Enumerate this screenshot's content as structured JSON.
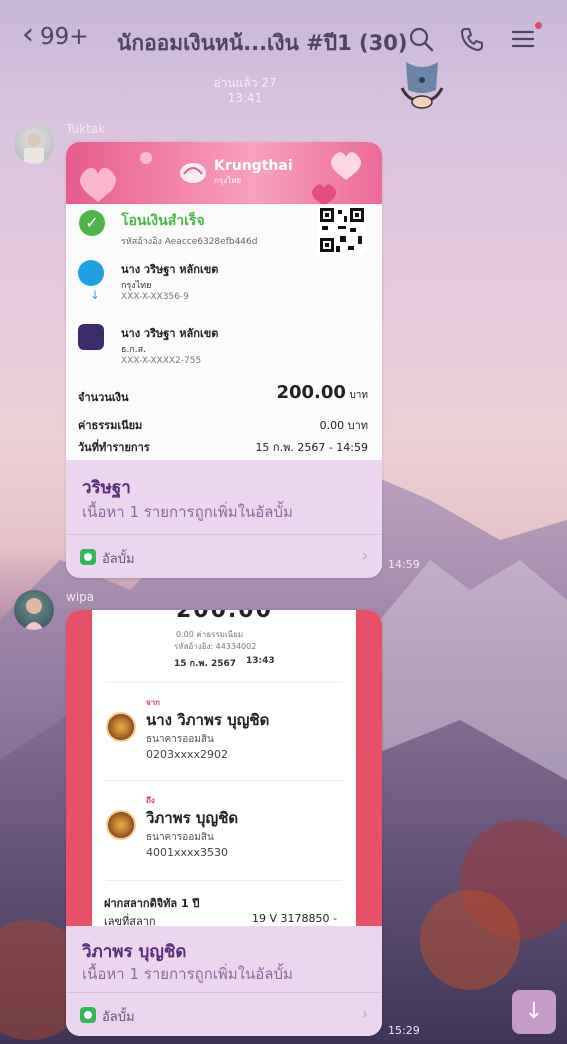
{
  "header": {
    "back_label": "99+",
    "title": "นักออมเงินหน้...เงิน #ปี1 (30)"
  },
  "read_status": {
    "label": "อ่านแล้ว 27",
    "time": "13:41"
  },
  "messages": [
    {
      "sender": "Tuktak",
      "time": "14:59",
      "slip": {
        "brand_name": "Krungthai",
        "brand_sub": "กรุงไทย",
        "status": "โอนเงินสำเร็จ",
        "ref": "รหัสอ้างอิง Aeacce6328efb446d",
        "from_name": "นาง วริษฐา หลักเขต",
        "from_bank": "กรุงไทย",
        "from_acct": "XXX-X-XX356-9",
        "to_name": "นาง วริษฐา หลักเขต",
        "to_bank": "ธ.ก.ส.",
        "to_acct": "XXX-X-XXXX2-755",
        "amount_label": "จำนวนเงิน",
        "amount": "200.00",
        "amount_unit": "บาท",
        "fee_label": "ค่าธรรมเนียม",
        "fee": "0.00 บาท",
        "date_label": "วันที่ทำรายการ",
        "date": "15 ก.พ. 2567 - 14:59"
      },
      "album_title": "วริษฐา",
      "album_desc": "เนื้อหา 1 รายการถูกเพิ่มในอัลบั้ม",
      "album_label": "อัลบั้ม"
    },
    {
      "sender": "wipa",
      "time": "15:29",
      "slip": {
        "amount_cut": "200.00",
        "fee_line": "0.00 ค่าธรรมเนียม",
        "ref_line": "รหัสอ้างอิง: 44334002",
        "date": "15 ก.พ. 2567",
        "time": "13:43",
        "from_tag": "จาก",
        "from_name": "นาง วิภาพร บุญชิด",
        "from_bank": "ธนาคารออมสิน",
        "from_acct": "0203xxxx2902",
        "to_tag": "ถึง",
        "to_name": "วิภาพร บุญชิด",
        "to_bank": "ธนาคารออมสิน",
        "to_acct": "4001xxxx3530",
        "product": "ฝากสลากดิจิทัล 1 ปี",
        "lot_label": "เลขที่สลาก",
        "lot_value": "19 V 3178850 -"
      },
      "album_title": "วิภาพร บุญชิด",
      "album_desc": "เนื้อหา 1 รายการถูกเพิ่มในอัลบั้ม",
      "album_label": "อัลบั้ม"
    }
  ],
  "icons": {
    "search": "search-icon",
    "call": "phone-icon",
    "menu": "menu-icon",
    "scroll": "arrow-down-icon"
  },
  "colors": {
    "success_green": "#4cb748",
    "album_bg": "#ecd6ef",
    "album_title": "#5a2c7a",
    "slip2_accent": "#e8506a"
  }
}
